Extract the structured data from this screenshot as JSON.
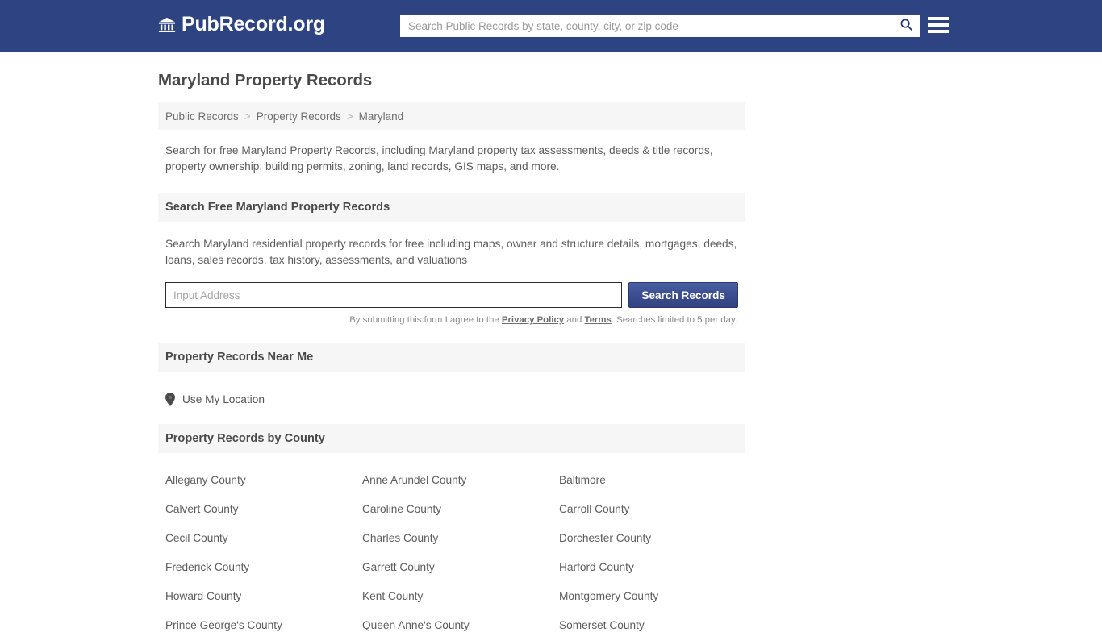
{
  "header": {
    "brand_name": "PubRecord.org",
    "brand_icon": "bank-building-icon",
    "search_placeholder": "Search Public Records by state, county, city, or zip code",
    "search_value": "",
    "search_icon": "search-icon",
    "menu_icon": "hamburger-menu-icon",
    "bg_color": "#2e4482"
  },
  "page": {
    "title": "Maryland Property Records",
    "intro": "Search for free Maryland Property Records, including Maryland property tax assessments, deeds & title records, property ownership, building permits, zoning, land records, GIS maps, and more."
  },
  "breadcrumb": {
    "items": [
      {
        "label": "Public Records"
      },
      {
        "label": "Property Records"
      },
      {
        "label": "Maryland"
      }
    ],
    "separator": ">"
  },
  "search_section": {
    "heading": "Search Free Maryland Property Records",
    "description": "Search Maryland residential property records for free including maps, owner and structure details, mortgages, deeds, loans, sales records, tax history, assessments, and valuations",
    "input_placeholder": "Input Address",
    "input_value": "",
    "submit_label": "Search Records",
    "submit_color": "#3d4f92",
    "disclaimer_prefix": "By submitting this form I agree to the ",
    "privacy_label": "Privacy Policy",
    "disclaimer_and": " and ",
    "terms_label": "Terms",
    "disclaimer_suffix": ". Searches limited to 5 per day."
  },
  "near_me_section": {
    "heading": "Property Records Near Me",
    "locate_label": "Use My Location",
    "locate_icon": "map-pin-icon"
  },
  "county_section": {
    "heading": "Property Records by County",
    "counties": [
      "Allegany County",
      "Anne Arundel County",
      "Baltimore",
      "Calvert County",
      "Caroline County",
      "Carroll County",
      "Cecil County",
      "Charles County",
      "Dorchester County",
      "Frederick County",
      "Garrett County",
      "Harford County",
      "Howard County",
      "Kent County",
      "Montgomery County",
      "Prince George's County",
      "Queen Anne's County",
      "Somerset County"
    ]
  }
}
